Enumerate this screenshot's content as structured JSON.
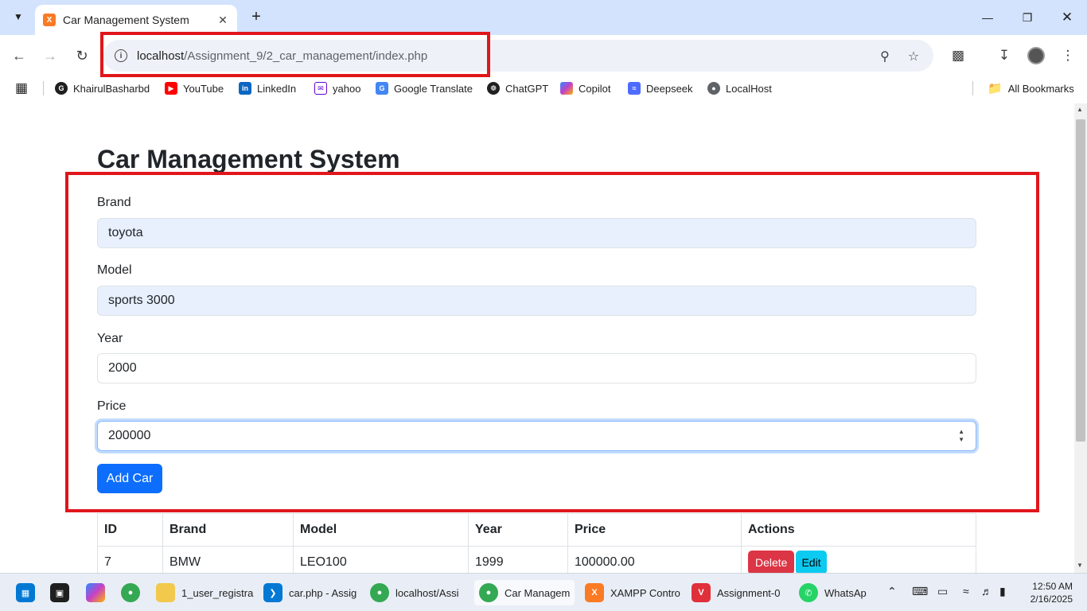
{
  "browser": {
    "tab_title": "Car Management System",
    "url_host": "localhost",
    "url_path": "/Assignment_9/2_car_management/index.php",
    "bookmarks": [
      "KhairulBasharbd",
      "YouTube",
      "LinkedIn",
      "yahoo",
      "Google Translate",
      "ChatGPT",
      "Copilot",
      "Deepseek",
      "LocalHost"
    ],
    "all_bookmarks": "All Bookmarks"
  },
  "page": {
    "title": "Car Management System",
    "form": {
      "brand_label": "Brand",
      "brand_value": "toyota",
      "model_label": "Model",
      "model_value": "sports 3000",
      "year_label": "Year",
      "year_value": "2000",
      "price_label": "Price",
      "price_value": "200000",
      "submit_label": "Add Car"
    },
    "table": {
      "headers": [
        "ID",
        "Brand",
        "Model",
        "Year",
        "Price",
        "Actions"
      ],
      "rows": [
        {
          "id": "7",
          "brand": "BMW",
          "model": "LEO100",
          "year": "1999",
          "price": "100000.00",
          "delete": "Delete",
          "edit": "Edit"
        }
      ]
    }
  },
  "taskbar": {
    "items": [
      "1_user_registra",
      "car.php - Assig",
      "localhost/Assi",
      "Car Managem",
      "XAMPP Contro",
      "Assignment-0",
      "WhatsAp"
    ],
    "time": "12:50 AM",
    "date": "2/16/2025"
  },
  "colors": {
    "primary": "#0d6efd",
    "danger": "#dc3545",
    "info": "#0dcaf0",
    "highlight": "#e0161b"
  }
}
